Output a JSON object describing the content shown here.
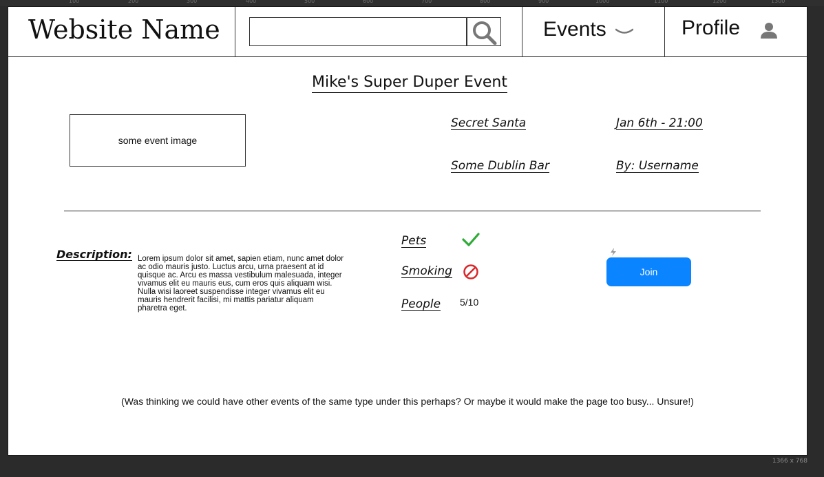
{
  "ruler_ticks": [
    "100",
    "200",
    "300",
    "400",
    "500",
    "600",
    "700",
    "800",
    "900",
    "1000",
    "1100",
    "1200",
    "1300"
  ],
  "header": {
    "site_name": "Website Name",
    "search": {
      "value": "",
      "placeholder": ""
    },
    "events_label": "Events",
    "profile_label": "Profile"
  },
  "event": {
    "title": "Mike's Super Duper Event",
    "image_placeholder": "some event image",
    "type": "Secret Santa",
    "datetime": "Jan 6th - 21:00",
    "location": "Some Dublin Bar",
    "host": "By: Username",
    "description_label": "Description:",
    "description_text": "Lorem ipsum dolor sit amet, sapien etiam, nunc amet dolor ac odio mauris justo. Luctus arcu, urna praesent at id quisque ac. Arcu es massa vestibulum malesuada, integer vivamus elit eu mauris eus, cum eros quis aliquam wisi. Nulla wisi laoreet suspendisse integer vivamus elit eu mauris hendrerit facilisi, mi mattis pariatur aliquam pharetra eget.",
    "attributes": {
      "pets_label": "Pets",
      "pets_allowed": true,
      "smoking_label": "Smoking",
      "smoking_allowed": false,
      "people_label": "People",
      "people_value": "5/10"
    },
    "join_label": "Join",
    "note": "(Was thinking we could have other events of the same type under this perhaps? Or maybe it would make the page too busy... Unsure!)"
  },
  "canvas_size_label": "1366 x 768",
  "colors": {
    "join_button": "#0a84ff",
    "check": "#2eab36",
    "no_symbol": "#d9262a",
    "backdrop": "#2b2b2b"
  }
}
